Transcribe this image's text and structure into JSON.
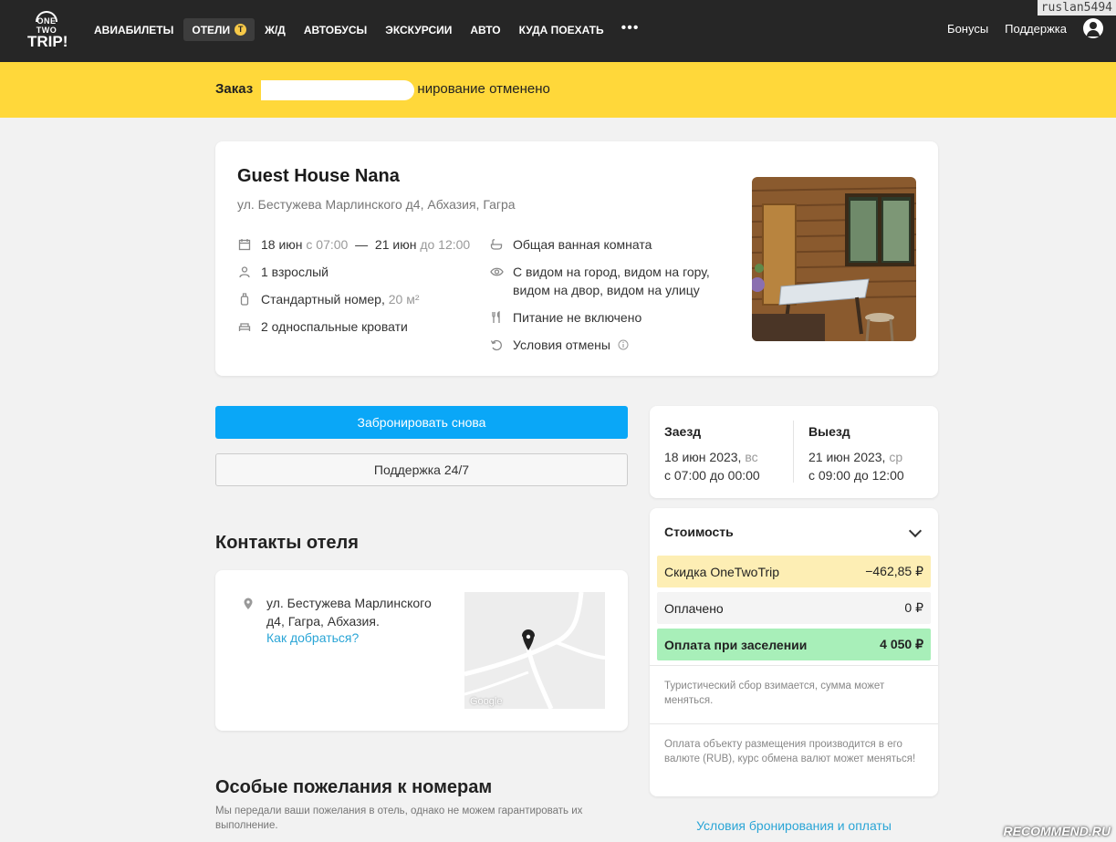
{
  "header": {
    "logo_top": "ONE TWO",
    "logo_bottom": "TRIP!",
    "nav": [
      "АВИАБИЛЕТЫ",
      "ОТЕЛИ",
      "Ж/Д",
      "АВТОБУСЫ",
      "ЭКСКУРСИИ",
      "АВТО",
      "КУДА ПОЕХАТЬ"
    ],
    "hotels_badge": "Т",
    "more": "•••",
    "bonuses": "Бонусы",
    "support": "Поддержка",
    "username": "ruslan5494"
  },
  "banner": {
    "prefix": "Заказ",
    "suffix": "нирование отменено"
  },
  "hotel": {
    "name": "Guest House Nana",
    "address": "ул. Бестужева Марлинского д4, Абхазия, Гагра",
    "dates": {
      "from_date": "18 июн",
      "from_time": "с 07:00",
      "dash": "—",
      "to_date": "21 июн",
      "to_time": "до 12:00"
    },
    "guests": "1 взрослый",
    "room": "Стандартный номер,",
    "room_size": "20 м²",
    "beds": "2 односпальные кровати",
    "bathroom": "Общая ванная комната",
    "view": "С видом на город, видом на гору, видом на двор, видом на улицу",
    "meals": "Питание не включено",
    "cancellation": "Условия отмены"
  },
  "actions": {
    "book_again": "Забронировать снова",
    "support247": "Поддержка 24/7"
  },
  "contacts": {
    "title": "Контакты отеля",
    "address": "ул. Бестужева Марлинского д4, Гагра, Абхазия.",
    "directions": "Как добраться?",
    "map_label": "Google"
  },
  "wishes": {
    "title": "Особые пожелания к номерам",
    "note": "Мы передали ваши пожелания в отель, однако не можем гарантировать их выполнение."
  },
  "stay": {
    "checkin_label": "Заезд",
    "checkin_date": "18 июн 2023,",
    "checkin_day": "вс",
    "checkin_time": "с 07:00 до 00:00",
    "checkout_label": "Выезд",
    "checkout_date": "21 июн 2023,",
    "checkout_day": "ср",
    "checkout_time": "с 09:00 до 12:00"
  },
  "cost": {
    "title": "Стоимость",
    "discount_label": "Скидка OneTwoTrip",
    "discount_value": "−462,85 ₽",
    "paid_label": "Оплачено",
    "paid_value": "0 ₽",
    "due_label": "Оплата при заселении",
    "due_value": "4 050 ₽",
    "note1": "Туристический сбор взимается, сумма может меняться.",
    "note2": "Оплата объекту размещения производится в его валюте (RUB), курс обмена валют может меняться!"
  },
  "terms_link": "Условия бронирования и оплаты",
  "watermark": "RECOMMEND.RU",
  "colors": {
    "header_bg": "#262626",
    "banner_bg": "#ffd83a",
    "primary_button": "#0aa7f7",
    "link": "#2aa5d6",
    "discount_bg": "#fdeeb4",
    "due_bg": "#a8efb9"
  }
}
